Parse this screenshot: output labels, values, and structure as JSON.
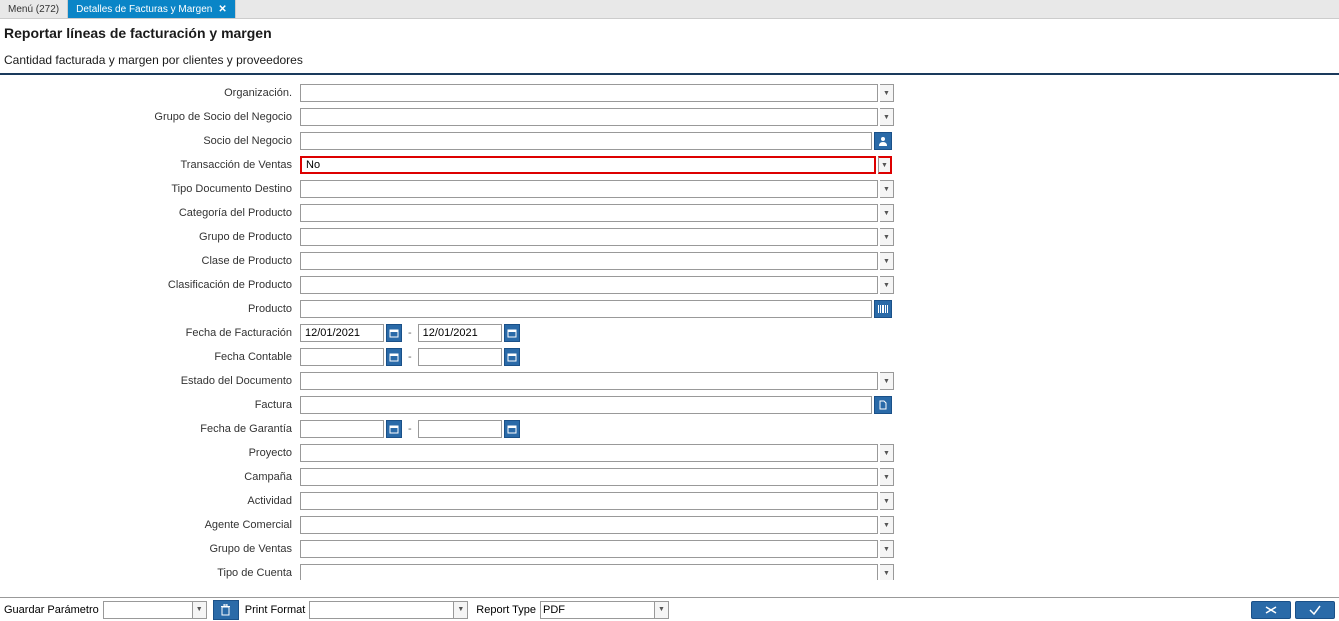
{
  "tabs": {
    "menu": "Menú (272)",
    "active": "Detalles de Facturas y Margen"
  },
  "header": {
    "title": "Reportar líneas de facturación y margen",
    "subtitle": "Cantidad facturada y margen por clientes y proveedores"
  },
  "form": {
    "organizacion": {
      "label": "Organización.",
      "value": ""
    },
    "grupo_socio": {
      "label": "Grupo de Socio del Negocio",
      "value": ""
    },
    "socio": {
      "label": "Socio del Negocio",
      "value": ""
    },
    "transaccion": {
      "label": "Transacción de Ventas",
      "value": "No"
    },
    "tipo_doc": {
      "label": "Tipo Documento Destino",
      "value": ""
    },
    "categoria": {
      "label": "Categoría del Producto",
      "value": ""
    },
    "grupo_prod": {
      "label": "Grupo de Producto",
      "value": ""
    },
    "clase_prod": {
      "label": "Clase de Producto",
      "value": ""
    },
    "clasif_prod": {
      "label": "Clasificación de Producto",
      "value": ""
    },
    "producto": {
      "label": "Producto",
      "value": ""
    },
    "fecha_fact": {
      "label": "Fecha de Facturación",
      "from": "12/01/2021",
      "to": "12/01/2021"
    },
    "fecha_cont": {
      "label": "Fecha Contable",
      "from": "",
      "to": ""
    },
    "estado": {
      "label": "Estado del Documento",
      "value": ""
    },
    "factura": {
      "label": "Factura",
      "value": ""
    },
    "fecha_gar": {
      "label": "Fecha de Garantía",
      "from": "",
      "to": ""
    },
    "proyecto": {
      "label": "Proyecto",
      "value": ""
    },
    "campana": {
      "label": "Campaña",
      "value": ""
    },
    "actividad": {
      "label": "Actividad",
      "value": ""
    },
    "agente": {
      "label": "Agente Comercial",
      "value": ""
    },
    "grupo_ventas": {
      "label": "Grupo de Ventas",
      "value": ""
    },
    "tipo_cuenta": {
      "label": "Tipo de Cuenta",
      "value": ""
    }
  },
  "bottom": {
    "guardar": "Guardar Parámetro",
    "print_format": "Print Format",
    "report_type": "Report Type",
    "report_type_value": "PDF"
  }
}
